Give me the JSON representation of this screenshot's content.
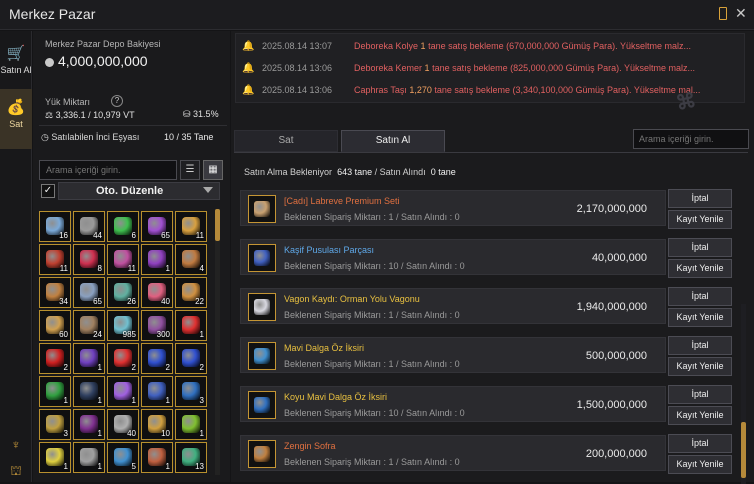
{
  "window": {
    "title": "Merkez Pazar"
  },
  "sidebar": {
    "items": [
      {
        "label": "Satın Al",
        "icon": "cart-icon"
      },
      {
        "label": "Sat",
        "icon": "bag-icon"
      }
    ]
  },
  "wallet": {
    "title": "Merkez Pazar Depo Bakiyesi",
    "amount": "4,000,000,000"
  },
  "weight": {
    "title": "Yük Miktarı",
    "help": "?",
    "value": "3,336.1 / 10,979 VT",
    "percent": "31.5%"
  },
  "sellable": {
    "label": "Satılabilen İnci Eşyası",
    "value": "10 / 35 Tane"
  },
  "left_search": {
    "placeholder": "Arama içeriği girin."
  },
  "sort": {
    "label": "Oto. Düzenle",
    "checked": "✓"
  },
  "inventory": [
    {
      "count": "16",
      "color": "#7aa9d8"
    },
    {
      "count": "44",
      "color": "#9a9a9a"
    },
    {
      "count": "6",
      "color": "#3fbf4f"
    },
    {
      "count": "65",
      "color": "#a050d0"
    },
    {
      "count": "11",
      "color": "#d8a040"
    },
    {
      "count": "11",
      "color": "#c04030"
    },
    {
      "count": "8",
      "color": "#d03050"
    },
    {
      "count": "11",
      "color": "#c050a0"
    },
    {
      "count": "1",
      "color": "#9040c0"
    },
    {
      "count": "4",
      "color": "#c07a40"
    },
    {
      "count": "34",
      "color": "#c08040"
    },
    {
      "count": "65",
      "color": "#8aa0c0"
    },
    {
      "count": "26",
      "color": "#60b0a0"
    },
    {
      "count": "40",
      "color": "#e06080"
    },
    {
      "count": "22",
      "color": "#d09040"
    },
    {
      "count": "60",
      "color": "#d0a050"
    },
    {
      "count": "24",
      "color": "#a08060"
    },
    {
      "count": "985",
      "color": "#70c0d0"
    },
    {
      "count": "300",
      "color": "#9050a0"
    },
    {
      "count": "1",
      "color": "#e03030"
    },
    {
      "count": "2",
      "color": "#d02020"
    },
    {
      "count": "1",
      "color": "#7040c0"
    },
    {
      "count": "2",
      "color": "#e03030"
    },
    {
      "count": "2",
      "color": "#3050d0"
    },
    {
      "count": "2",
      "color": "#3050d0"
    },
    {
      "count": "1",
      "color": "#30a040"
    },
    {
      "count": "1",
      "color": "#304060"
    },
    {
      "count": "1",
      "color": "#a060e0"
    },
    {
      "count": "1",
      "color": "#4060c0"
    },
    {
      "count": "3",
      "color": "#3070c0"
    },
    {
      "count": "3",
      "color": "#c0a040"
    },
    {
      "count": "1",
      "color": "#803090"
    },
    {
      "count": "40",
      "color": "#b0b0b0"
    },
    {
      "count": "10",
      "color": "#d0a040"
    },
    {
      "count": "1",
      "color": "#80c030"
    },
    {
      "count": "1",
      "color": "#e0d040"
    },
    {
      "count": "1",
      "color": "#a0a0a0"
    },
    {
      "count": "5",
      "color": "#4090d0"
    },
    {
      "count": "1",
      "color": "#c06040"
    },
    {
      "count": "13",
      "color": "#40b080"
    }
  ],
  "notices": [
    {
      "time": "2025.08.14 13:07",
      "pre": "Deboreka Kolye ",
      "n": "1",
      "post": " tane satış bekleme (670,000,000 Gümüş Para). Yükseltme malz..."
    },
    {
      "time": "2025.08.14 13:06",
      "pre": "Deboreka Kemer ",
      "n": "1",
      "post": " tane satış bekleme (825,000,000 Gümüş Para). Yükseltme malz..."
    },
    {
      "time": "2025.08.14 13:06",
      "pre": "Caphras Taşı ",
      "n": "1,270",
      "post": " tane satış bekleme (3,340,100,000 Gümüş Para). Yükseltme mal..."
    }
  ],
  "tabs": {
    "sell": "Sat",
    "buy": "Satın Al"
  },
  "right_search": {
    "placeholder": "Arama içeriği girin."
  },
  "summary": {
    "label1": "Satın Alma Bekleniyor",
    "value1": "643 tane",
    "sep": "/",
    "label2": "Satın Alındı",
    "value2": "0 tane"
  },
  "orders": [
    {
      "name": "[Cadı] Labreve Premium Seti",
      "name_color": "#e07040",
      "sub": "Beklenen Sipariş Miktarı : 1 / Satın Alındı : 0",
      "price": "2,170,000,000",
      "icon_color": "#c8a070"
    },
    {
      "name": "Kaşif Pusulası Parçası",
      "name_color": "#5fa8e8",
      "sub": "Beklenen Sipariş Miktarı : 10 / Satın Alındı : 0",
      "price": "40,000,000",
      "icon_color": "#4060c0"
    },
    {
      "name": "Vagon Kaydı: Orman Yolu Vagonu",
      "name_color": "#e8c040",
      "sub": "Beklenen Sipariş Miktarı : 1 / Satın Alındı : 0",
      "price": "1,940,000,000",
      "icon_color": "#d8d8e0"
    },
    {
      "name": "Mavi Dalga Öz İksiri",
      "name_color": "#e8c040",
      "sub": "Beklenen Sipariş Miktarı : 1 / Satın Alındı : 0",
      "price": "500,000,000",
      "icon_color": "#4090d0"
    },
    {
      "name": "Koyu Mavi Dalga Öz İksiri",
      "name_color": "#e8c040",
      "sub": "Beklenen Sipariş Miktarı : 10 / Satın Alındı : 0",
      "price": "1,500,000,000",
      "icon_color": "#3070c0"
    },
    {
      "name": "Zengin Sofra",
      "name_color": "#e07040",
      "sub": "Beklenen Sipariş Miktarı : 1 / Satın Alındı : 0",
      "price": "200,000,000",
      "icon_color": "#c08040"
    }
  ],
  "buttons": {
    "cancel": "İptal",
    "renew": "Kayıt Yenile"
  }
}
